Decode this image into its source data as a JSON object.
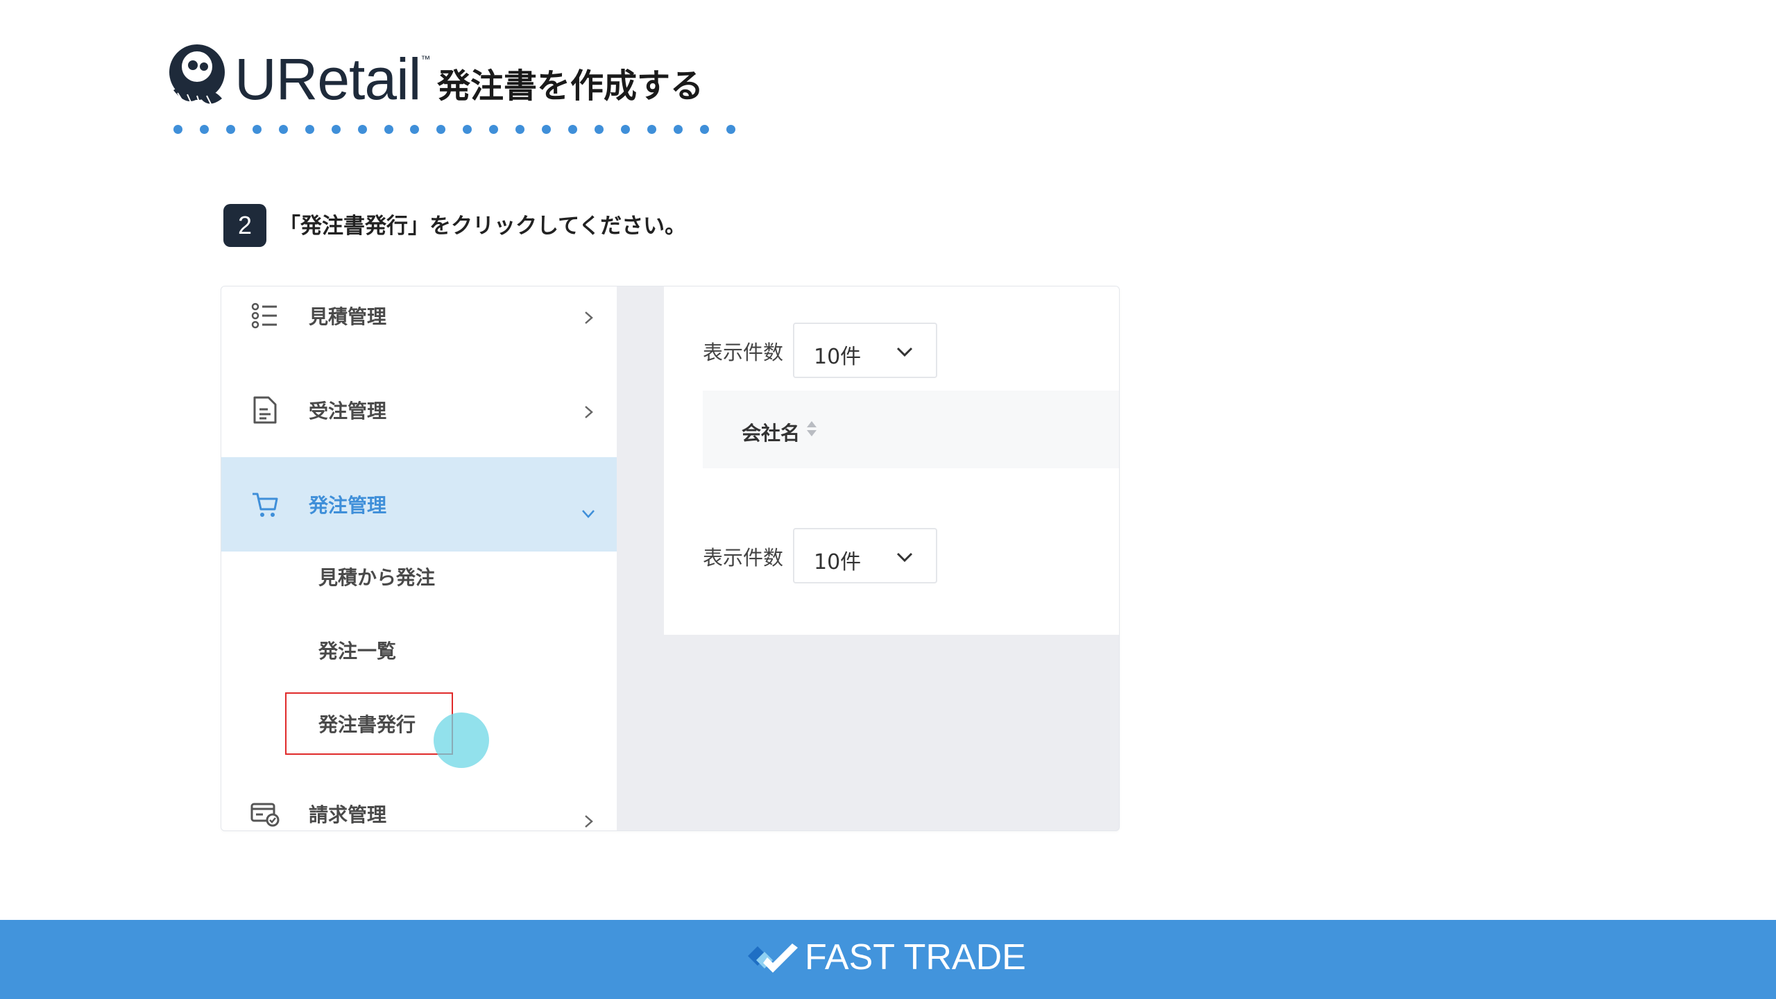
{
  "header": {
    "brand": "URetail",
    "brand_tm": "™",
    "title": "発注書を作成する"
  },
  "step": {
    "number": "2",
    "instruction": "「発注書発行」をクリックしてください。"
  },
  "screenshot": {
    "sidebar": {
      "items": [
        {
          "label": "見積管理",
          "icon": "list-icon",
          "expanded": false
        },
        {
          "label": "受注管理",
          "icon": "document-icon",
          "expanded": false
        },
        {
          "label": "発注管理",
          "icon": "cart-icon",
          "expanded": true,
          "active": true
        },
        {
          "label": "請求管理",
          "icon": "invoice-icon",
          "expanded": false
        }
      ],
      "subitems": [
        {
          "label": "見積から発注"
        },
        {
          "label": "発注一覧"
        },
        {
          "label": "発注書発行",
          "highlighted": true
        }
      ]
    },
    "content": {
      "display_count_label": "表示件数",
      "display_count_value": "10件",
      "table_header": "会社名"
    }
  },
  "footer": {
    "brand": "FAST TRADE"
  },
  "colors": {
    "accent_blue": "#4294dc",
    "active_bg": "#d6e9f7",
    "highlight_red": "#e02b2b",
    "dark_navy": "#1e2a3a"
  }
}
